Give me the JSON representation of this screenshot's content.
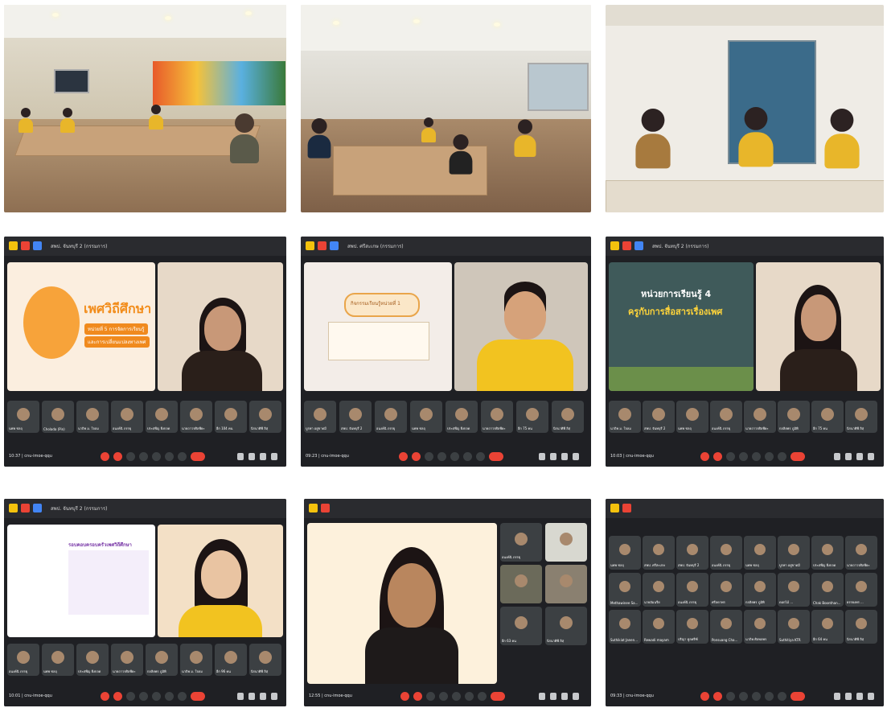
{
  "meet_titles": {
    "t4": "สพป. จันทบุรี 2 (กรรมการ)",
    "t5": "สพป. ศรีสะเกษ (กรรมการ)",
    "t6": "สพป. จันทบุรี 2 (กรรมการ)",
    "t7": "สพป. จันทบุรี 2 (กรรมการ)"
  },
  "slides": {
    "t4_title": "เพศวิถีศึกษา",
    "t4_sub": "หน่วยที่ 5 การจัดการเรียนรู้",
    "t4_sub2": "และการเปลี่ยนแปลงทางเพศ",
    "t5_title": "กิจกรรมเรียนรู้หน่วยที่ 1",
    "t6_line1": "หน่วยการเรียนรู้ 4",
    "t6_line2": "ครูกับการสื่อสารเรื่องเพศ",
    "t7_title": "รอบคอบครอบครัวเพศวิถีศึกษา"
  },
  "clocks": {
    "t4": "10:37 | cnu-imoe-qqu",
    "t5": "09:23 | cnu-imoe-qqu",
    "t6": "10:03 | cnu-imoe-qqu",
    "t7": "10:01 | cnu-imoe-qqu",
    "t8": "12:55 | cnu-imoe-qqu",
    "t9": "09:33 | cnu-imoe-qqu"
  },
  "thumbs_t4": [
    "นพพ ชลฤ",
    "Cholada (Pin)",
    "นาถิพ ม. ใจลม",
    "อนงค์นิ ภรรยุ",
    "ประสพีญ ยิ่งกลด",
    "นายถาวรศิลพียะ",
    "อีก 104 คน",
    "นิรนาศิพี ลิสฺ"
  ],
  "thumbs_t5": [
    "บูรพา อยู่ขาดมี",
    "สพป. จันทบุรี 2",
    "อนงค์นิ ภรรยุ",
    "นพพ ชลฤ",
    "ประสพีญ ยิ่งกลด",
    "นายถาวรศิลพียะ",
    "อีก 75 คน",
    "นิรนาศิพี ลิสฺ"
  ],
  "thumbs_t6": [
    "นาถิพ ม. ใจลม",
    "สพป. จันทบุรี 2",
    "นพพ ชลฤ",
    "อนงค์นิ ภรรยุ",
    "นายถาวรศิลพียะ",
    "กลลิยพร ภูมิพิ",
    "อีก 75 คน",
    "นิรนาศิพี ลิสฺ"
  ],
  "thumbs_t7": [
    "อนงค์นิ ภรรยุ",
    "นพพ ชลฤ",
    "ประสพีญ ยิ่งกลด",
    "นายถาวรศิลพียะ",
    "กลลิยพร ภูมิพิ",
    "นาถิพ ม. ใจลม",
    "อีก 96 คน",
    "นิรนาศิพี ลิสฺ"
  ],
  "side_t8": [
    "อนงค์นิ ภรรยุ",
    "",
    "อีก 63 คน",
    "นิรนาศิพี ลิสฺ"
  ],
  "grid_t9": [
    "นพพ ชลฤ",
    "สพป. ศรีสะเกษ",
    "สพป. จันทบุรี 2",
    "อนงค์นิ ภรรยุ",
    "นพพ ชลฤ",
    "บูรพา อยู่ขาดมี",
    "ประสพีญ ยิ่งกลด",
    "นายถาวรศิลพียะ",
    "Methawinee Sa...",
    "นายอัมนรีย",
    "อนงค์นิ ภรรยุ",
    "ศรีลดาพร",
    "กลลิยพร ภูมิพิ",
    "ดอกไม้ ...",
    "Chak Boonthan...",
    "ยรรยงพร ...",
    "Suthikiat Janen...",
    "Rewadi mayam",
    "ปริญา ทูลพรีฑ์",
    "Ponsuang Cha...",
    "นาถิพ ศิลพลพร",
    "Suthitiya KTR",
    "อีก 64 คน",
    "นิรนาศิพี ลิสฺ"
  ],
  "colors": {
    "meet_bg": "#1f2024",
    "end_call": "#ea4335",
    "accent_orange": "#f28c1a"
  }
}
